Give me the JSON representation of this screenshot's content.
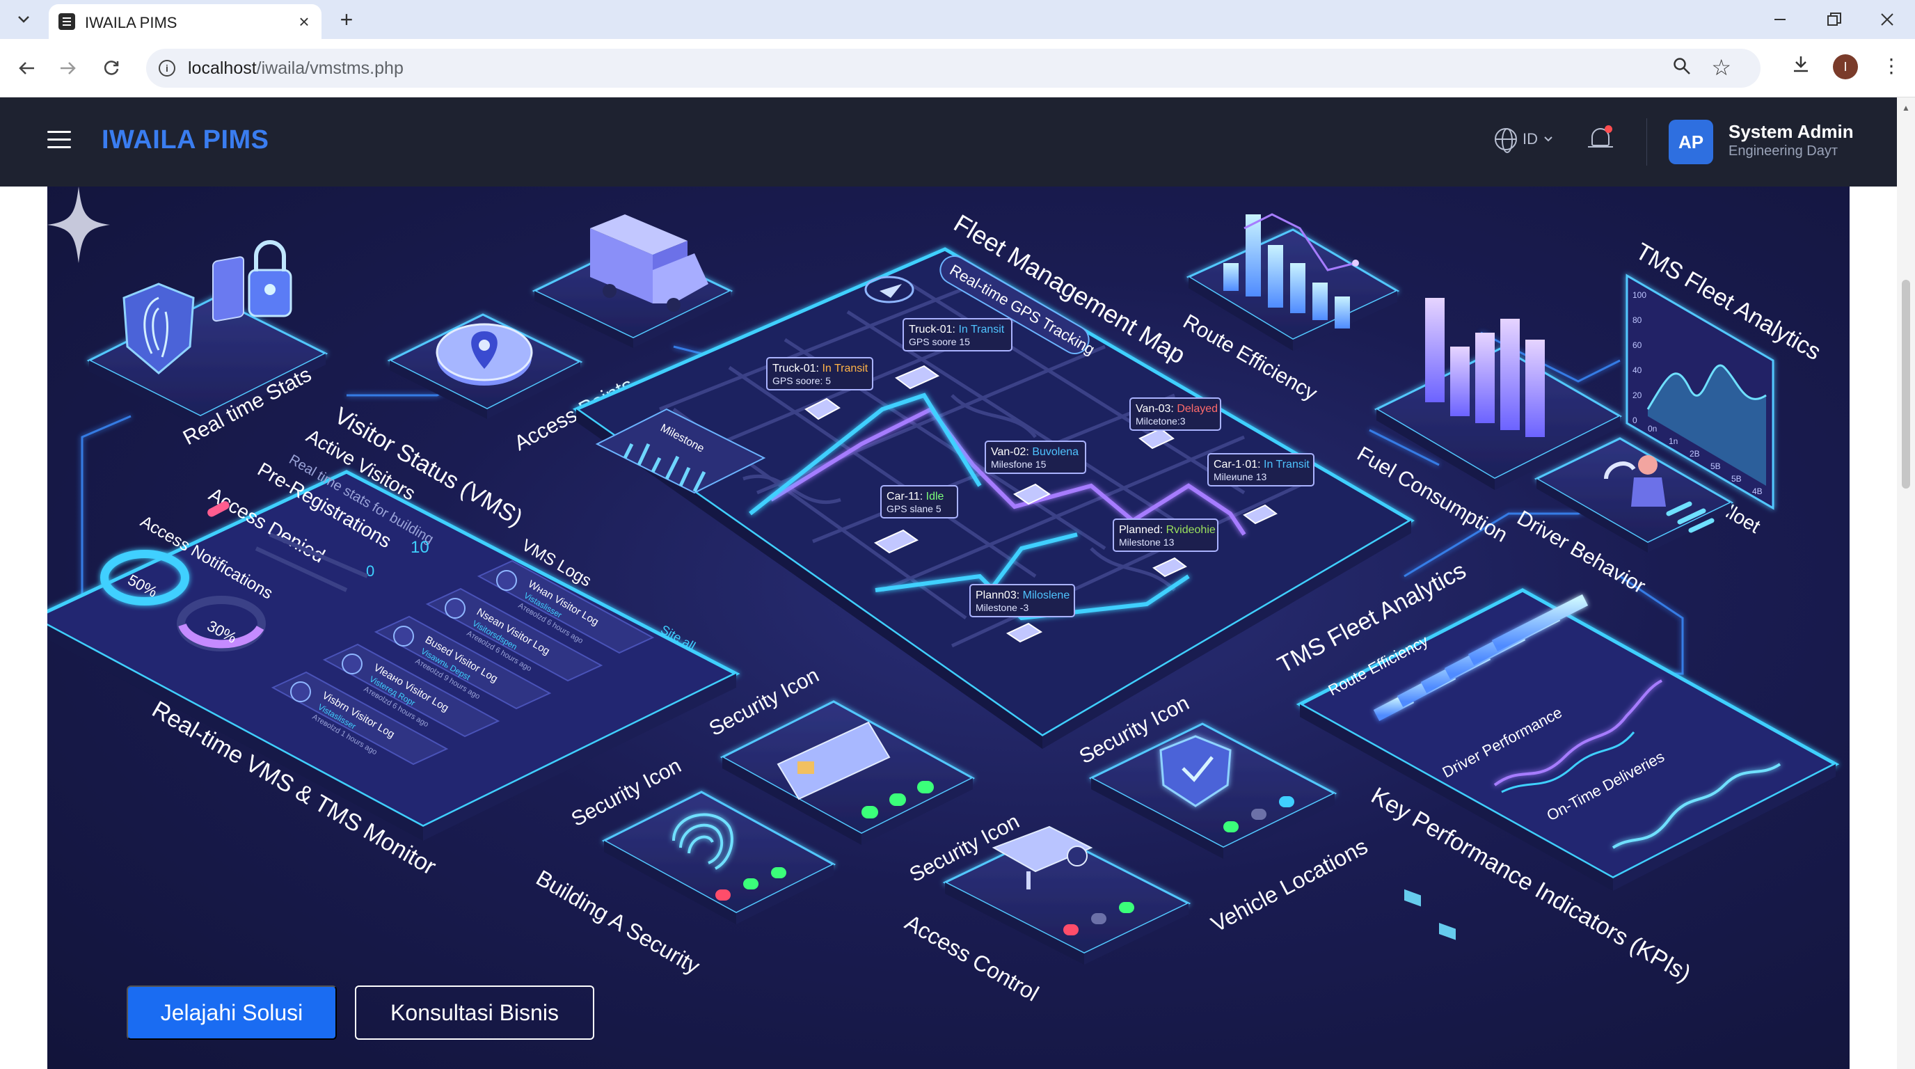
{
  "browser": {
    "tab_title": "IWAILA PIMS",
    "url_host": "localhost",
    "url_path": "/iwaila/vmstms.php",
    "profile_initial": "I"
  },
  "header": {
    "brand": "IWAILA PIMS",
    "language": "ID",
    "user_initials": "AP",
    "user_name": "System Admin",
    "user_role": "Engineering Dayт"
  },
  "hero": {
    "labels": {
      "realtime_stats": "Real time Stats",
      "access_points": "Access Points",
      "fleet_map": "Fleet Management Map",
      "gps_tracking": "Real-time GPS Tracking",
      "route_efficiency": "Route Efficiency",
      "tms_fleet_analytics_top": "TMS Fleet Analytics",
      "fuel_consumption": "Fuel Consumption",
      "fuel_fleet": "Fuel ci lloet",
      "driver_behavior": "Driver Behavior",
      "visitor_status": "Visitor Status (VMS)",
      "active_visitors": "Active Visitors",
      "realtime_building": "Real time stats for building",
      "pre_registrations": "Pre-Registrations",
      "access_denied": "Access Denied",
      "access_notifications": "Access Notifications",
      "stat_10": "10",
      "stat_0": "0",
      "pct_50": "50%",
      "pct_30": "30%",
      "vms_logs": "VMS Logs",
      "see_all": "Site all",
      "vms_monitor": "Real-time VMS & TMS Monitor",
      "milestone_panel": "Milestone",
      "security_icon": "Security Icon",
      "building_security": "Building A Security",
      "access_control": "Access Control",
      "vehicle_locations": "Vehicle Locations",
      "tms_fleet_analytics": "TMS Fleet Analytics",
      "route_eff_chart": "Route Efficiency",
      "driver_perf": "Driver Performance",
      "on_time": "On-Time Deliveries",
      "kpis": "Key Performance Indicators (KPIs)"
    },
    "vms_logs": [
      {
        "title": "Wнаn Visitor Log",
        "sub": "Vistaslisser",
        "time": "Aтевоlzd 6 hours ago"
      },
      {
        "title": "Nsean Visitor Log",
        "sub": "Visitorsdspen",
        "time": "Aтевоlzd 6 hours ago"
      },
      {
        "title": "Bused Visitor Log",
        "sub": "Visawnь Depst",
        "time": "Aтевоlzd 9 hours ago"
      },
      {
        "title": "Vleaнo Visitor Log",
        "sub": "Vistereд Ropr",
        "time": "Aтевоlzd 6 hours ago"
      },
      {
        "title": "Visbrn Visitor Log",
        "sub": "Vistaslisser",
        "time": "Aтевоlzd 1 hours ago"
      }
    ],
    "vehicles": [
      {
        "name": "Truck-01:",
        "status": "In Transit",
        "status_color": "#4fc3ff",
        "sub": "GPS soore 15"
      },
      {
        "name": "Truck-01:",
        "status": "In Transit",
        "status_color": "#ffb347",
        "sub": "GPS soore: 5"
      },
      {
        "name": "Van-03:",
        "status": "Delayed",
        "status_color": "#ff6b6b",
        "sub": "Milcetone:3"
      },
      {
        "name": "Van-02:",
        "status": "Buvolena",
        "status_color": "#4fc3ff",
        "sub": "Milesfone 15"
      },
      {
        "name": "Car-1·01:",
        "status": "In Transit",
        "status_color": "#4fc3ff",
        "sub": "Mileиune 13"
      },
      {
        "name": "Car-11:",
        "status": "Idle",
        "status_color": "#7dff7a",
        "sub": "GPS slane 5"
      },
      {
        "name": "Planned:",
        "status": "Rvideohie",
        "status_color": "#9be15d",
        "sub": "Milestone 13"
      },
      {
        "name": "Plann03:",
        "status": "Miloslene",
        "status_color": "#4fc3ff",
        "sub": "Milestone -3"
      }
    ],
    "top_axis_ticks": [
      "100",
      "80",
      "60",
      "40",
      "20",
      "0"
    ],
    "bottom_axis_ticks": [
      "0n",
      "1n",
      "2B",
      "5B",
      "5B",
      "4B"
    ]
  },
  "cta": {
    "primary": "Jelajahi Solusi",
    "secondary": "Konsultasi Bisnis"
  },
  "colors": {
    "header_bg": "#1e2230",
    "brand": "#3a7df0",
    "primary_button": "#1a6cf2",
    "accent_cyan": "#3fd0ff",
    "accent_purple": "#a67cff"
  }
}
